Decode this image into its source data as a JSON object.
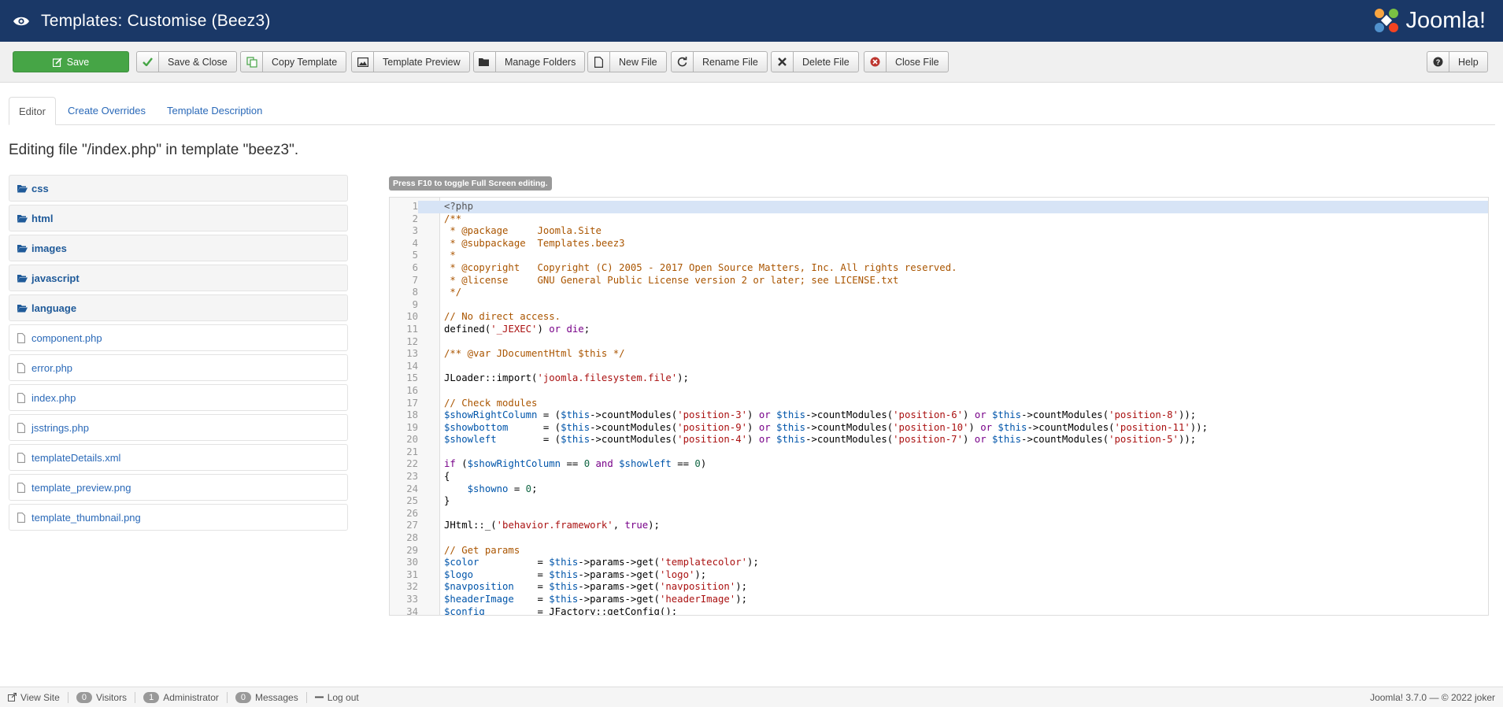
{
  "header": {
    "title": "Templates: Customise (Beez3)",
    "logo_text": "Joomla!"
  },
  "toolbar": {
    "save": "Save",
    "save_close": "Save & Close",
    "copy_template": "Copy Template",
    "template_preview": "Template Preview",
    "manage_folders": "Manage Folders",
    "new_file": "New File",
    "rename_file": "Rename File",
    "delete_file": "Delete File",
    "close_file": "Close File",
    "help": "Help"
  },
  "tabs": [
    "Editor",
    "Create Overrides",
    "Template Description"
  ],
  "heading": "Editing file \"/index.php\" in template \"beez3\".",
  "tree": {
    "folders": [
      "css",
      "html",
      "images",
      "javascript",
      "language"
    ],
    "files": [
      "component.php",
      "error.php",
      "index.php",
      "jsstrings.php",
      "templateDetails.xml",
      "template_preview.png",
      "template_thumbnail.png"
    ]
  },
  "editor_hint": "Press F10 to toggle Full Screen editing.",
  "code_lines": [
    "<?php",
    "/**",
    " * @package     Joomla.Site",
    " * @subpackage  Templates.beez3",
    " *",
    " * @copyright   Copyright (C) 2005 - 2017 Open Source Matters, Inc. All rights reserved.",
    " * @license     GNU General Public License version 2 or later; see LICENSE.txt",
    " */",
    "",
    "// No direct access.",
    "defined('_JEXEC') or die;",
    "",
    "/** @var JDocumentHtml $this */",
    "",
    "JLoader::import('joomla.filesystem.file');",
    "",
    "// Check modules",
    "$showRightColumn = ($this->countModules('position-3') or $this->countModules('position-6') or $this->countModules('position-8'));",
    "$showbottom      = ($this->countModules('position-9') or $this->countModules('position-10') or $this->countModules('position-11'));",
    "$showleft        = ($this->countModules('position-4') or $this->countModules('position-7') or $this->countModules('position-5'));",
    "",
    "if ($showRightColumn == 0 and $showleft == 0)",
    "{",
    "    $showno = 0;",
    "}",
    "",
    "JHtml::_('behavior.framework', true);",
    "",
    "// Get params",
    "$color          = $this->params->get('templatecolor');",
    "$logo           = $this->params->get('logo');",
    "$navposition    = $this->params->get('navposition');",
    "$headerImage    = $this->params->get('headerImage');",
    "$config         = JFactory::getConfig();"
  ],
  "status": {
    "view_site": "View Site",
    "visitors_count": "0",
    "visitors_label": "Visitors",
    "admin_count": "1",
    "admin_label": "Administrator",
    "messages_count": "0",
    "messages_label": "Messages",
    "logout": "Log out",
    "version": "Joomla! 3.7.0 — © 2022 joker"
  }
}
